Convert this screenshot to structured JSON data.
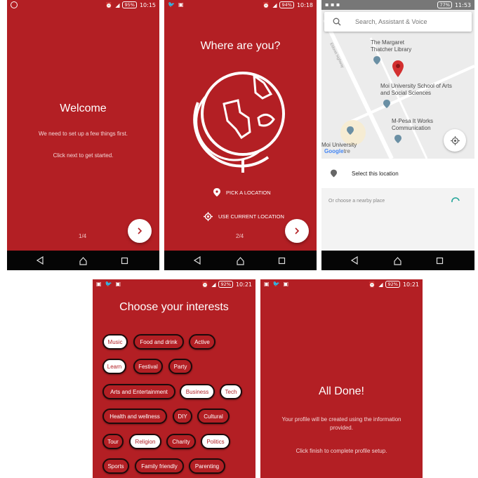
{
  "colors": {
    "brand": "#b31f24",
    "navbar": "#050505",
    "map_bg": "#e8e8e8",
    "pin": "#d32f2f"
  },
  "screen1": {
    "status": {
      "app_icon": "whatsapp-icon",
      "battery": "95%",
      "time": "10:15"
    },
    "title": "Welcome",
    "line1": "We need to set up a few things first.",
    "line2": "Click next to get started.",
    "pager": "1/4",
    "next_icon": "chevron-right-icon"
  },
  "screen2": {
    "status": {
      "battery": "94%",
      "time": "10:18"
    },
    "title": "Where are you?",
    "pick_label": "PICK A LOCATION",
    "current_label": "USE CURRENT LOCATION",
    "pager": "2/4",
    "globe_icon": "globe-icon"
  },
  "screen3": {
    "status": {
      "battery": "77%",
      "time": "11:53"
    },
    "search_placeholder": "Search, Assistant & Voice",
    "map_labels": {
      "library": "The Margaret Thatcher Library",
      "school": "Moi University School of Arts and Social Sciences",
      "mpesa": "M-Pesa It Works Communication",
      "moi": "Moi University",
      "highway": "Eldoret highway",
      "google": "Google",
      "tre": "tre"
    },
    "select_location": "Select this location",
    "nearby": "Or choose a nearby place"
  },
  "screen4": {
    "status": {
      "battery": "92%",
      "time": "10:21"
    },
    "title": "Choose your interests",
    "chips": [
      {
        "label": "Music",
        "selected": true
      },
      {
        "label": "Food and drink",
        "selected": false
      },
      {
        "label": "Active",
        "selected": false
      },
      {
        "label": "Learn",
        "selected": true
      },
      {
        "label": "Festival",
        "selected": false
      },
      {
        "label": "Party",
        "selected": false
      },
      {
        "label": "Arts and Entertainment",
        "selected": false
      },
      {
        "label": "Business",
        "selected": true
      },
      {
        "label": "Tech",
        "selected": true
      },
      {
        "label": "Health and wellness",
        "selected": false
      },
      {
        "label": "DIY",
        "selected": false
      },
      {
        "label": "Cultural",
        "selected": false
      },
      {
        "label": "Tour",
        "selected": false
      },
      {
        "label": "Religion",
        "selected": true
      },
      {
        "label": "Charity",
        "selected": false
      },
      {
        "label": "Politics",
        "selected": true
      },
      {
        "label": "Sports",
        "selected": false
      },
      {
        "label": "Family friendly",
        "selected": false
      },
      {
        "label": "Parenting",
        "selected": false
      }
    ]
  },
  "screen5": {
    "status": {
      "battery": "92%",
      "time": "10:21"
    },
    "title": "All Done!",
    "line1": "Your profile will be created using the information",
    "line2": "provided.",
    "line3": "Click finish to complete profile setup."
  }
}
